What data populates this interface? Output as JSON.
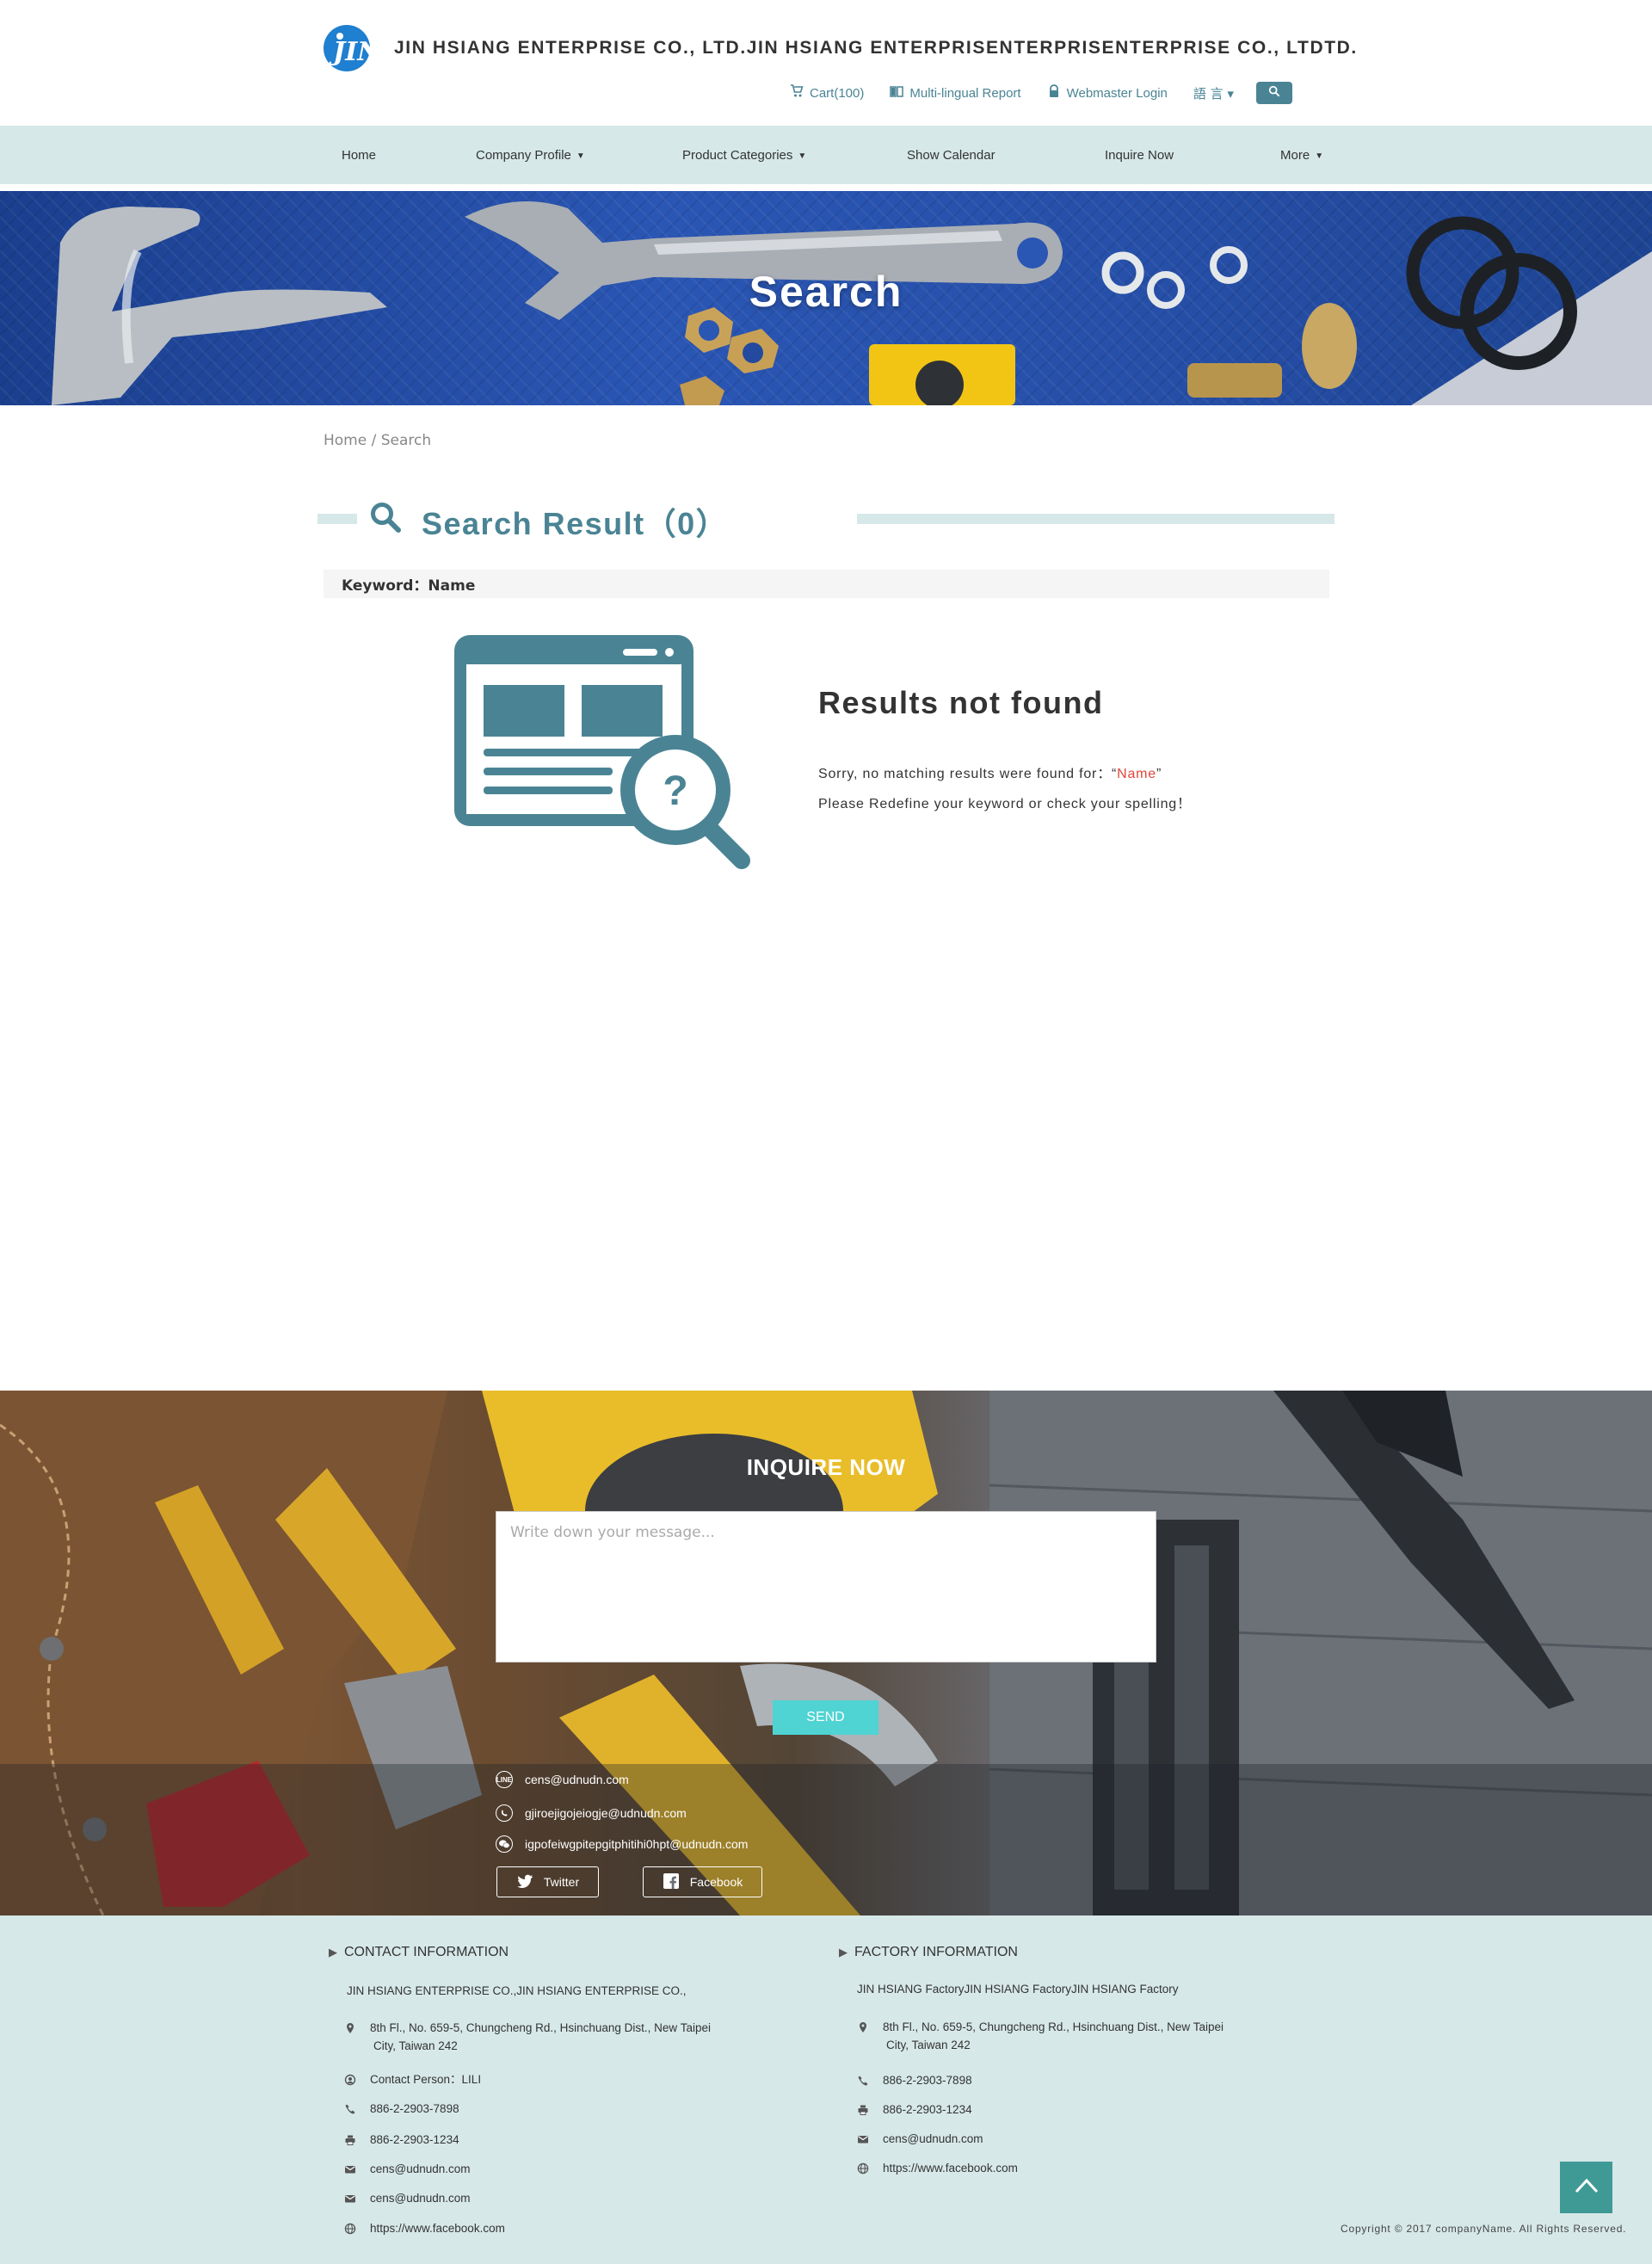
{
  "header": {
    "logo_text": "JIN",
    "site_title": "JIN HSIANG ENTERPRISE CO., LTD.JIN HSIANG ENTERPRISENTERPRISENTERPRISE CO., LTDTD.",
    "links": {
      "cart": "Cart(100)",
      "report": "Multi-lingual Report",
      "login": "Webmaster Login",
      "language": "語 言 ▾"
    },
    "icons": {
      "cart": "cart-icon",
      "report": "book-icon",
      "login": "lock-icon",
      "search": "search-icon"
    }
  },
  "nav": {
    "items": [
      {
        "label": "Home",
        "has_dropdown": false
      },
      {
        "label": "Company Profile",
        "has_dropdown": true
      },
      {
        "label": "Product Categories",
        "has_dropdown": true
      },
      {
        "label": "Show Calendar",
        "has_dropdown": false
      },
      {
        "label": "Inquire Now",
        "has_dropdown": false
      },
      {
        "label": "More",
        "has_dropdown": true
      }
    ],
    "chevron": "⌄"
  },
  "banner": {
    "title": "Search"
  },
  "breadcrumb": {
    "home": "Home",
    "separator": " / ",
    "current": "Search"
  },
  "results": {
    "title": "Search Result（0）",
    "keyword_label": "Keyword：Name",
    "not_found_title": "Results not found",
    "sorry_prefix": "Sorry, no matching results were found for：“",
    "keyword": "Name",
    "sorry_suffix": "”",
    "hint": "Please Redefine your keyword or check your spelling！"
  },
  "inquire": {
    "title": "INQUIRE NOW",
    "placeholder": "Write down your message...",
    "send_label": "SEND",
    "contacts": [
      {
        "icon": "line-icon",
        "badge": "LINE",
        "value": "cens@udnudn.com"
      },
      {
        "icon": "whatsapp-icon",
        "badge": "",
        "value": "gjiroejigojeiogje@udnudn.com"
      },
      {
        "icon": "wechat-icon",
        "badge": "",
        "value": "igpofeiwgpitepgitphitihi0hpt@udnudn.com"
      }
    ],
    "social": {
      "twitter": "Twitter",
      "facebook": "Facebook"
    }
  },
  "footer": {
    "contact": {
      "heading": "CONTACT INFORMATION",
      "company": "JIN HSIANG ENTERPRISE CO.,JIN HSIANG ENTERPRISE CO.,",
      "address_line1": "8th Fl., No. 659-5, Chungcheng Rd., Hsinchuang Dist., New Taipei",
      "address_line2": "City, Taiwan 242",
      "contact_person": "Contact Person：LILI",
      "phone": "886-2-2903-7898",
      "fax": "886-2-2903-1234",
      "email1": "cens@udnudn.com",
      "email2": "cens@udnudn.com",
      "website": "https://www.facebook.com"
    },
    "factory": {
      "heading": "FACTORY INFORMATION",
      "company": "JIN HSIANG FactoryJIN HSIANG FactoryJIN HSIANG Factory",
      "address_line1": "8th Fl., No. 659-5, Chungcheng Rd., Hsinchuang Dist., New Taipei",
      "address_line2": "City, Taiwan 242",
      "phone": "886-2-2903-7898",
      "fax": "886-2-2903-1234",
      "email": "cens@udnudn.com",
      "website": "https://www.facebook.com"
    },
    "copyright": "Copyright © 2017 companyName. All Rights Reserved."
  },
  "colors": {
    "accent": "#4a8494",
    "nav_bg": "#d7e8e8",
    "send": "#4fd3d3",
    "keyword": "#e0453c",
    "to_top": "#3f9a96"
  }
}
